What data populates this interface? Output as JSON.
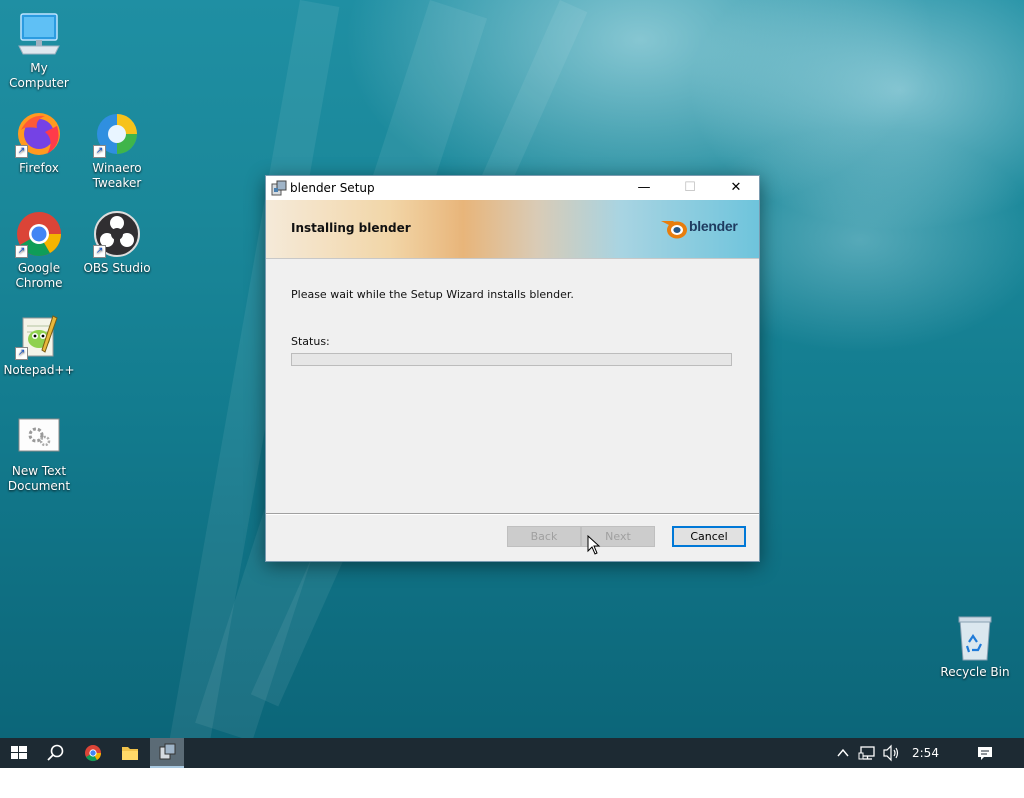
{
  "desktop": {
    "icons": [
      {
        "name": "my-computer",
        "label": "My Computer"
      },
      {
        "name": "firefox",
        "label": "Firefox"
      },
      {
        "name": "winaero-tweaker",
        "label": "Winaero Tweaker"
      },
      {
        "name": "google-chrome",
        "label": "Google Chrome"
      },
      {
        "name": "obs-studio",
        "label": "OBS Studio"
      },
      {
        "name": "notepad-plus-plus",
        "label": "Notepad++"
      },
      {
        "name": "new-text-document",
        "label": "New Text Document"
      },
      {
        "name": "recycle-bin",
        "label": "Recycle Bin"
      }
    ]
  },
  "dialog": {
    "title": "blender Setup",
    "window_buttons": {
      "minimize": "—",
      "maximize": "☐",
      "close": "✕"
    },
    "heading": "Installing blender",
    "logo_text": "blender",
    "message": "Please wait while the Setup Wizard installs blender.",
    "status_label": "Status:",
    "progress_fraction": 0,
    "buttons": {
      "back": "Back",
      "next": "Next",
      "cancel": "Cancel"
    }
  },
  "taskbar": {
    "clock": "2:54 PM",
    "pinned": [
      "start-icon",
      "search-icon",
      "chrome-icon",
      "file-explorer-icon",
      "setup-icon"
    ],
    "tray_icons": [
      "chevron-up-icon",
      "network-icon",
      "volume-icon",
      "notification-icon"
    ]
  },
  "colors": {
    "accent": "#0078d7",
    "taskbar": "#1d2a33",
    "dialog_bg": "#f0f0f0"
  }
}
